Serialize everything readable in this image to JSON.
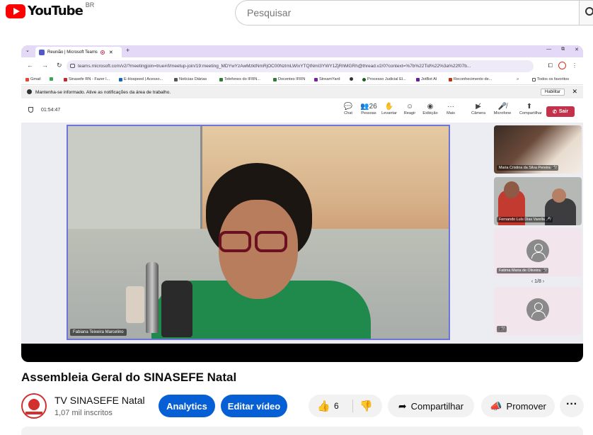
{
  "youtube": {
    "logo_text": "YouTube",
    "region": "BR",
    "search_placeholder": "Pesquisar"
  },
  "browser": {
    "tab_title": "Reunião | Microsoft Teams",
    "url": "teams.microsoft.com/v2/?meetingjoin=true#/l/meetup-join/19:meeting_MDYwYzAwMzktNmRjOC00NzlmLWIxYTQtNmI3YWY1ZjRhMGRh@thread.v2/0?context=%7b%22Tid%22%3a%22f07b...",
    "bookmarks": [
      {
        "label": "Gmail",
        "color": "#ea4335"
      },
      {
        "label": "",
        "color": "#34a853"
      },
      {
        "label": "Sinasefe RN - Fazer l...",
        "color": "#c62828"
      },
      {
        "label": "E-Hospeed | Acesso...",
        "color": "#1565c0"
      },
      {
        "label": "Notícias Diárias",
        "color": "#555555"
      },
      {
        "label": "Telefones do IFRN...",
        "color": "#2e7d32"
      },
      {
        "label": "Docentes IFRN",
        "color": "#2e7d32"
      },
      {
        "label": "StreamYard",
        "color": "#7b1fa2"
      },
      {
        "label": "",
        "color": "#333333"
      },
      {
        "label": "Processo Judicial El...",
        "color": "#1b5e20"
      },
      {
        "label": "JotBot AI",
        "color": "#6a1b9a"
      },
      {
        "label": "Reconhecimento de...",
        "color": "#bf360c"
      }
    ],
    "all_favorites": "Todos os favoritos",
    "notification_text": "Mantenha-se informado. Ative as notificações da área de trabalho.",
    "notification_button": "Habilitar"
  },
  "teams": {
    "timer": "01:54:47",
    "toolbar": [
      {
        "label": "Chat",
        "glyph": "💬"
      },
      {
        "label": "Pessoas",
        "glyph": "👥26"
      },
      {
        "label": "Levantar",
        "glyph": "✋"
      },
      {
        "label": "Reagir",
        "glyph": "☺"
      },
      {
        "label": "Exibição",
        "glyph": "◉"
      },
      {
        "label": "Mais",
        "glyph": "···"
      },
      {
        "label": "Câmera",
        "glyph": "▶̸"
      },
      {
        "label": "Microfone",
        "glyph": "🎤̸"
      },
      {
        "label": "Compartilhar",
        "glyph": "⬆"
      }
    ],
    "leave_label": "Sair",
    "main_participant": "Fabiana Teixeira Marcelino",
    "side_participants": [
      "Maria Cristina da Silva Pereira",
      "Fernando Luís Dias Varella",
      "Fatima Maria de Oliveira"
    ],
    "pager": "1/8",
    "colors": {
      "accent": "#6f75d8",
      "leave": "#c4314b"
    }
  },
  "video": {
    "title": "Assembleia Geral do SINASEFE Natal",
    "channel_name": "TV SINASEFE Natal",
    "subscribers": "1,07 mil inscritos",
    "analytics_label": "Analytics",
    "edit_label": "Editar vídeo",
    "like_count": "6",
    "share_label": "Compartilhar",
    "promote_label": "Promover",
    "more_label": "···"
  }
}
